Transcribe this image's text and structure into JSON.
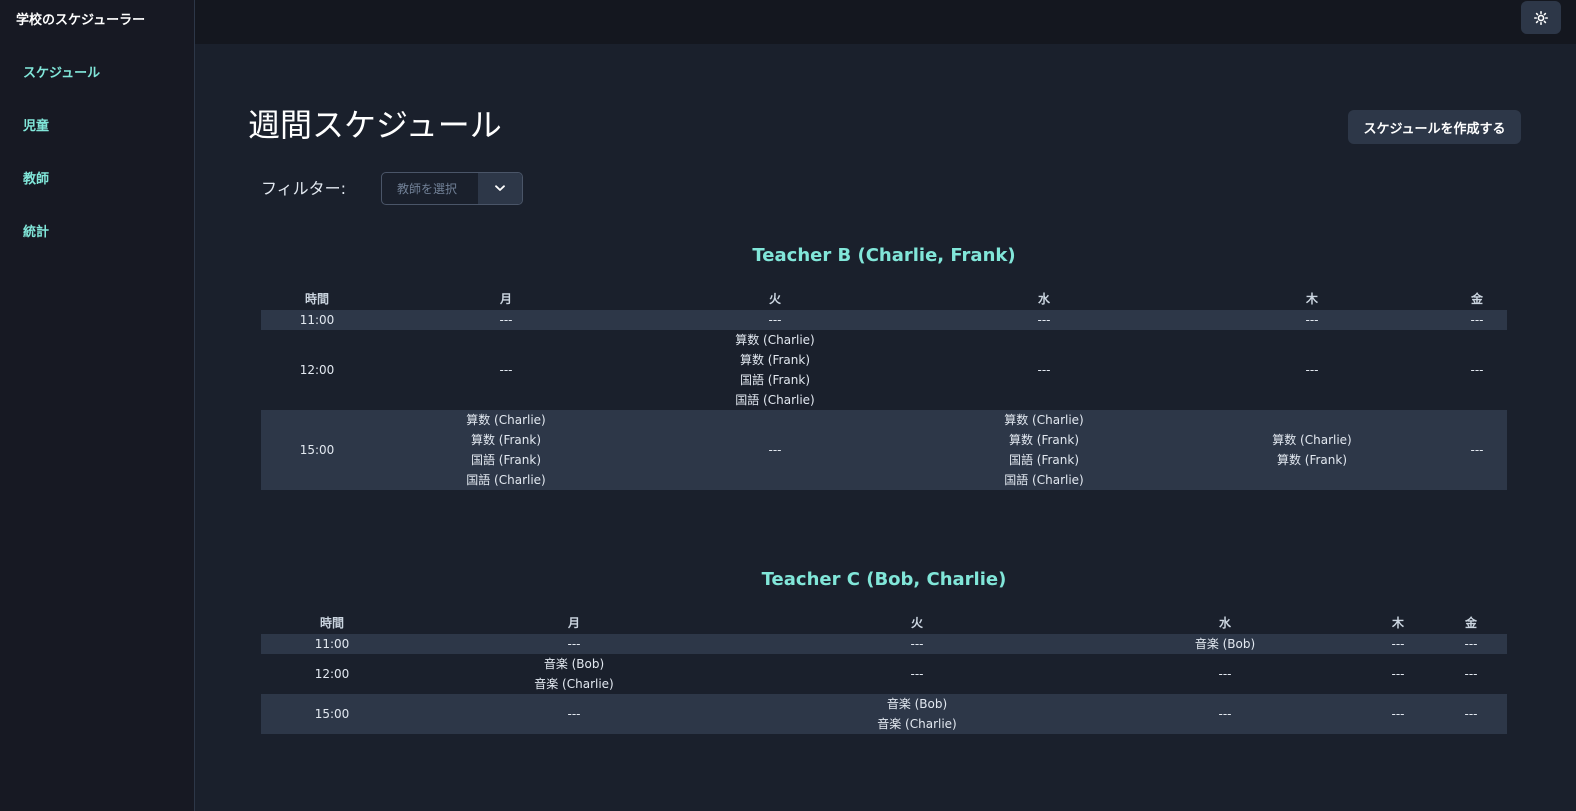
{
  "app": {
    "title": "学校のスケジューラー"
  },
  "sidebar": {
    "items": [
      {
        "label": "スケジュール"
      },
      {
        "label": "児童"
      },
      {
        "label": "教師"
      },
      {
        "label": "統計"
      }
    ]
  },
  "header": {
    "theme_icon": "sun-icon"
  },
  "main": {
    "title": "週間スケジュール",
    "create_button": "スケジュールを作成する",
    "filter": {
      "label": "フィルター:",
      "placeholder": "教師を選択",
      "icon": "chevron-down-icon"
    }
  },
  "schedules": [
    {
      "title": "Teacher B (Charlie, Frank)",
      "columns": [
        "時間",
        "月",
        "火",
        "水",
        "木",
        "金"
      ],
      "rows": [
        {
          "time": "11:00",
          "cells": [
            [
              "---"
            ],
            [
              "---"
            ],
            [
              "---"
            ],
            [
              "---"
            ],
            [
              "---"
            ]
          ]
        },
        {
          "time": "12:00",
          "cells": [
            [
              "---"
            ],
            [
              "算数 (Charlie)",
              "算数 (Frank)",
              "国語 (Frank)",
              "国語 (Charlie)"
            ],
            [
              "---"
            ],
            [
              "---"
            ],
            [
              "---"
            ]
          ]
        },
        {
          "time": "15:00",
          "cells": [
            [
              "算数 (Charlie)",
              "算数 (Frank)",
              "国語 (Frank)",
              "国語 (Charlie)"
            ],
            [
              "---"
            ],
            [
              "算数 (Charlie)",
              "算数 (Frank)",
              "国語 (Frank)",
              "国語 (Charlie)"
            ],
            [
              "算数 (Charlie)",
              "算数 (Frank)"
            ],
            [
              "---"
            ]
          ]
        }
      ]
    },
    {
      "title": "Teacher C (Bob, Charlie)",
      "columns": [
        "時間",
        "月",
        "火",
        "水",
        "木",
        "金"
      ],
      "rows": [
        {
          "time": "11:00",
          "cells": [
            [
              "---"
            ],
            [
              "---"
            ],
            [
              "音楽 (Bob)"
            ],
            [
              "---"
            ],
            [
              "---"
            ]
          ]
        },
        {
          "time": "12:00",
          "cells": [
            [
              "音楽 (Bob)",
              "音楽 (Charlie)"
            ],
            [
              "---"
            ],
            [
              "---"
            ],
            [
              "---"
            ],
            [
              "---"
            ]
          ]
        },
        {
          "time": "15:00",
          "cells": [
            [
              "---"
            ],
            [
              "音楽 (Bob)",
              "音楽 (Charlie)"
            ],
            [
              "---"
            ],
            [
              "---"
            ],
            [
              "---"
            ]
          ]
        }
      ]
    }
  ]
}
